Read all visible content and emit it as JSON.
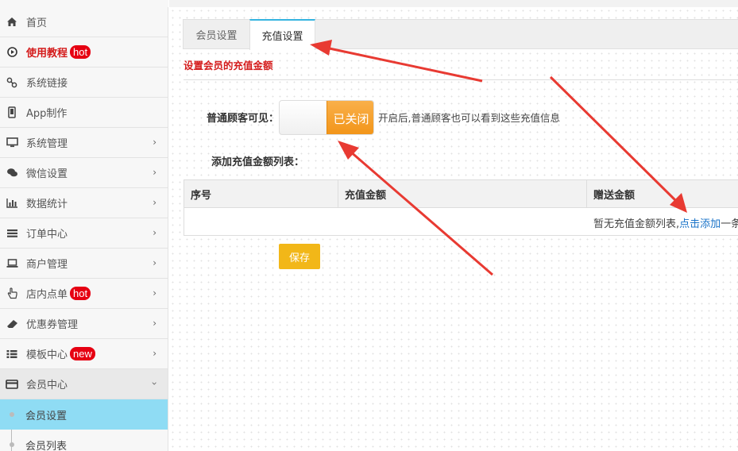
{
  "sidebar": {
    "items": [
      {
        "label": "首页",
        "icon": "home-icon"
      },
      {
        "label": "使用教程",
        "badge": "hot",
        "icon": "play-circle-icon"
      },
      {
        "label": "系统链接",
        "icon": "link-icon"
      },
      {
        "label": "App制作",
        "icon": "phone-icon"
      },
      {
        "label": "系统管理",
        "icon": "monitor-icon"
      },
      {
        "label": "微信设置",
        "icon": "chat-icon"
      },
      {
        "label": "数据统计",
        "icon": "bar-chart-icon"
      },
      {
        "label": "订单中心",
        "icon": "list-icon"
      },
      {
        "label": "商户管理",
        "icon": "laptop-icon"
      },
      {
        "label": "店内点单",
        "badge": "hot",
        "icon": "pointer-hand-icon"
      },
      {
        "label": "优惠券管理",
        "icon": "eraser-icon"
      },
      {
        "label": "模板中心",
        "badge": "new",
        "icon": "th-list-icon"
      },
      {
        "label": "会员中心",
        "icon": "credit-card-icon"
      }
    ],
    "sub_items": [
      {
        "label": "会员设置"
      },
      {
        "label": "会员列表"
      }
    ]
  },
  "tabs": [
    {
      "label": "会员设置"
    },
    {
      "label": "充值设置"
    }
  ],
  "section_title": "设置会员的充值金额",
  "visibility": {
    "label": "普通顾客可见：",
    "toggle_text": "已关闭",
    "hint": "开启后,普通顾客也可以看到这些充值信息"
  },
  "list_label": "添加充值金额列表：",
  "table": {
    "columns": [
      "序号",
      "充值金额",
      "赠送金额"
    ],
    "empty_text": "暂无充值金额列表,",
    "add_link": "点击添加",
    "empty_suffix": "一条"
  },
  "save_label": "保存",
  "colors": {
    "accent_red": "#d41b1b",
    "toggle_orange": "#f29417",
    "save_yellow": "#f2b718",
    "active_sub_bg": "#8fdcf4",
    "tab_border": "#35b4e0",
    "link_blue": "#1a73c8",
    "arrow_red": "#e83a32"
  }
}
